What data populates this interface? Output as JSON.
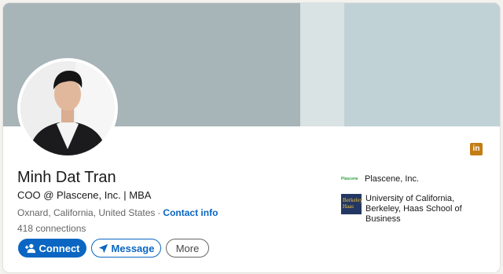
{
  "profile": {
    "name": "Minh Dat Tran",
    "headline": "COO @ Plascene, Inc. | MBA",
    "location": "Oxnard, California, United States",
    "separator": "·",
    "contact_info": "Contact info",
    "connections": "418 connections"
  },
  "actions": {
    "connect": "Connect",
    "message": "Message",
    "more": "More"
  },
  "sidebar": {
    "company": "Plascene, Inc.",
    "company_logo_text": "Plascene",
    "school": "University of California, Berkeley, Haas School of Business",
    "school_logo_text": "Berkeley Haas"
  },
  "brand": {
    "linkedin_badge": "in",
    "accent": "#0a66c2",
    "badge_color": "#c37d16"
  },
  "icons": [
    "linkedin-icon",
    "add-person-icon",
    "send-icon"
  ]
}
